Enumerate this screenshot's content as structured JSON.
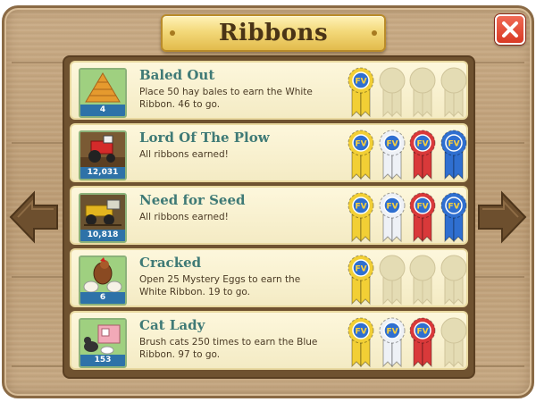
{
  "window": {
    "title": "Ribbons",
    "close_symbol": "✕"
  },
  "badge_text": "FV",
  "colors": {
    "gold": "#f2cf35",
    "white": "#eef1f6",
    "red": "#d9393a",
    "blue": "#2f6fd0",
    "empty": "#e4dcb4",
    "title_text": "#3f7a76",
    "count_bg": "#2e72a8"
  },
  "ribbon_tiers": [
    "gold",
    "white",
    "red",
    "blue"
  ],
  "achievements": [
    {
      "title": "Baled Out",
      "description": "Place 50 hay bales to earn the White Ribbon. 46 to go.",
      "count": "4",
      "icon": "hay-bales-icon",
      "ribbons_earned": 1
    },
    {
      "title": "Lord Of The Plow",
      "description": "All ribbons earned!",
      "count": "12,031",
      "icon": "tractor-plow-icon",
      "ribbons_earned": 4
    },
    {
      "title": "Need for Seed",
      "description": "All ribbons earned!",
      "count": "10,818",
      "icon": "seeder-icon",
      "ribbons_earned": 4
    },
    {
      "title": "Cracked",
      "description": "Open 25 Mystery Eggs to earn the White Ribbon. 19 to go.",
      "count": "6",
      "icon": "chicken-eggs-icon",
      "ribbons_earned": 1
    },
    {
      "title": "Cat Lady",
      "description": "Brush cats 250 times to earn the Blue Ribbon. 97 to go.",
      "count": "153",
      "icon": "cats-icon",
      "ribbons_earned": 3
    }
  ]
}
